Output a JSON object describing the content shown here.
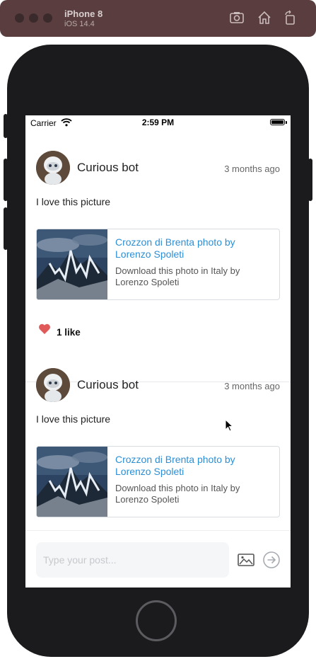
{
  "simulator": {
    "device_name": "iPhone 8",
    "os_version": "iOS 14.4",
    "icons": [
      "screenshot-icon",
      "home-icon",
      "rotate-icon"
    ]
  },
  "status_bar": {
    "carrier": "Carrier",
    "time": "2:59 PM"
  },
  "posts": [
    {
      "username": "Curious bot",
      "time_ago": "3 months ago",
      "text": "I love this picture",
      "link_card": {
        "title": "Crozzon di Brenta photo by Lorenzo Spoleti",
        "description": "Download this photo in Italy by Lorenzo Spoleti"
      },
      "likes_label": "1 like"
    },
    {
      "username": "Curious bot",
      "time_ago": "3 months ago",
      "text": "I love this picture",
      "link_card": {
        "title": "Crozzon di Brenta photo by Lorenzo Spoleti",
        "description": "Download this photo in Italy by Lorenzo Spoleti"
      }
    }
  ],
  "composer": {
    "placeholder": "Type your post...",
    "value": ""
  },
  "colors": {
    "link": "#2b8fd6",
    "heart": "#e05a5a",
    "simulator_bar": "#5a3d3e"
  }
}
